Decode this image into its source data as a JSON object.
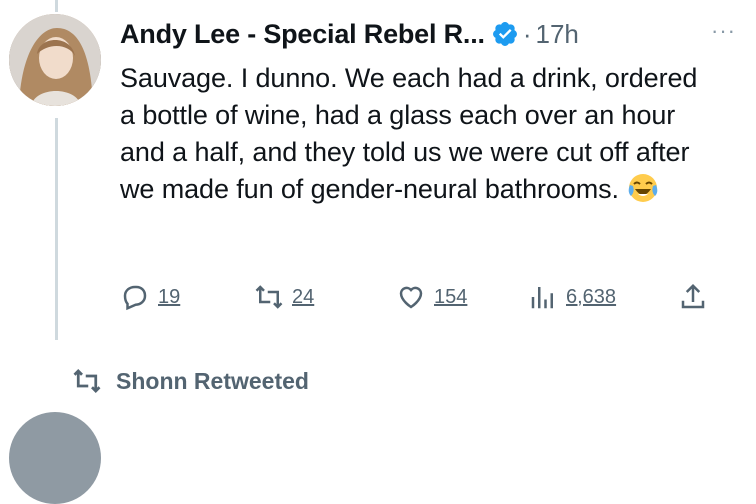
{
  "tweet": {
    "author_name": "Andy Lee - Special Rebel R...",
    "separator": "·",
    "time": "17h",
    "more_label": "···",
    "text": "Sauvage. I dunno. We each had a drink, ordered a bottle of wine, had a glass each over an hour and a half, and they told us we were cut off after we made fun of gender-neural bathrooms.",
    "emoji_icon": "face-with-tears-of-joy-icon"
  },
  "actions": {
    "reply_count": "19",
    "retweet_count": "24",
    "like_count": "154",
    "views_count": "6,638"
  },
  "social_context": {
    "label": "Shonn Retweeted"
  },
  "colors": {
    "text": "#0f1419",
    "secondary": "#536471",
    "verified": "#1d9bf0",
    "thread_line": "#cfd9de"
  }
}
